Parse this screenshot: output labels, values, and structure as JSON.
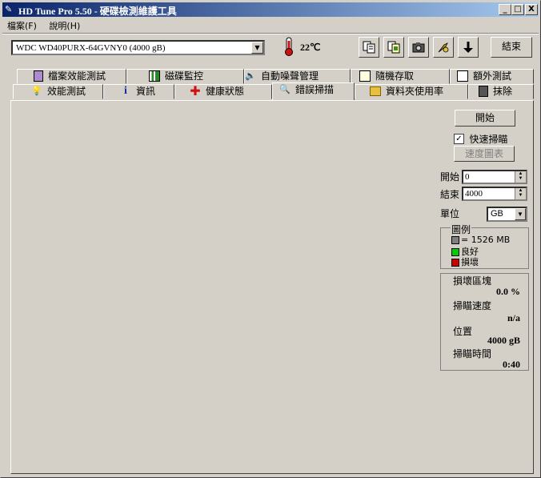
{
  "window": {
    "title": "HD Tune Pro 5.50 - 硬碟檢測維護工具",
    "minimize": "_",
    "maximize": "□",
    "close": "X"
  },
  "menu": {
    "items": [
      "檔案(F)",
      "說明(H)"
    ]
  },
  "toolbar": {
    "drive": "WDC WD40PURX-64GVNY0 (4000 gB)",
    "temperature": "22℃",
    "exit_label": "結束",
    "icons": [
      "copy-text-icon",
      "copy-screen-icon",
      "camera-icon",
      "options-icon",
      "download-icon"
    ]
  },
  "tabs": {
    "row1": [
      "檔案效能測試",
      "磁碟監控",
      "自動噪聲管理",
      "隨機存取",
      "額外測試"
    ],
    "row2": [
      "效能測試",
      "資訊",
      "健康狀態",
      "錯誤掃描",
      "資料夾使用率",
      "抹除"
    ],
    "active": "錯誤掃描"
  },
  "scan": {
    "start_button": "開始",
    "quick_scan_label": "快速掃瞄",
    "quick_scan_checked": true,
    "speed_chart_button": "速度圖表",
    "start_label": "開始",
    "start_value": "0",
    "end_label": "結束",
    "end_value": "4000",
    "unit_label": "單位",
    "unit_value": "GB",
    "legend": {
      "title": "圖例",
      "block_size": "= 1526 MB",
      "good": "良好",
      "damaged": "損壞",
      "colors": {
        "block": "#808080",
        "good": "#00cc00",
        "damaged": "#cc0000"
      }
    },
    "stats": {
      "damaged_blocks_label": "損壞區塊",
      "damaged_blocks_value": "0.0 %",
      "scan_speed_label": "掃瞄速度",
      "scan_speed_value": "n/a",
      "position_label": "位置",
      "position_value": "4000 gB",
      "scan_time_label": "掃瞄時間",
      "scan_time_value": "0:40"
    },
    "grid_color": "#00cc00"
  }
}
